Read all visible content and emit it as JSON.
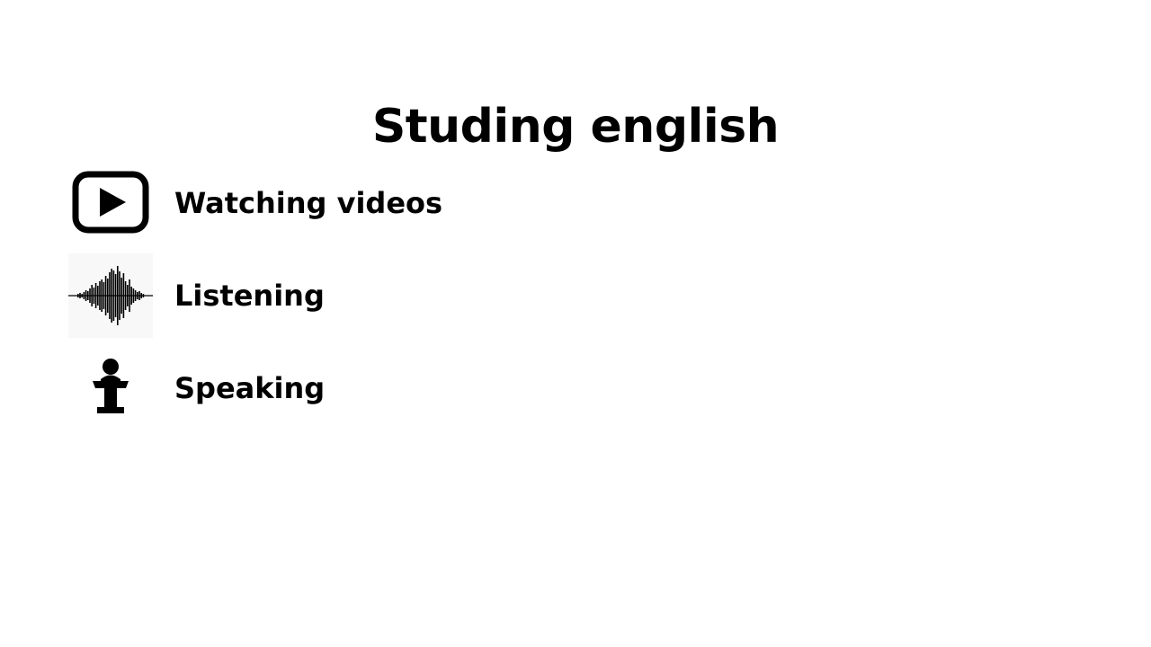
{
  "slide": {
    "title": "Studing english",
    "items": [
      {
        "label": "Watching videos",
        "icon": "video-play-icon"
      },
      {
        "label": "Listening",
        "icon": "sound-waveform-icon"
      },
      {
        "label": "Speaking",
        "icon": "speaker-podium-icon"
      }
    ]
  },
  "colors": {
    "background": "#ffffff",
    "text": "#000000",
    "icon": "#000000"
  }
}
